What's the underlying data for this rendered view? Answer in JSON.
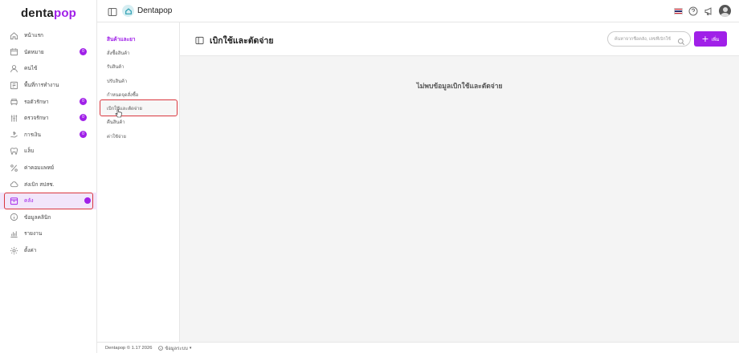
{
  "app": {
    "logo_main": "denta",
    "logo_accent": "pop",
    "brand_name": "Dentapop"
  },
  "colors": {
    "accent": "#a020e8",
    "highlight": "#d9363e"
  },
  "sidebar": {
    "items": [
      {
        "label": "หน้าแรก",
        "icon": "home-icon",
        "badge": ""
      },
      {
        "label": "นัดหมาย",
        "icon": "calendar-icon",
        "badge": "0"
      },
      {
        "label": "คนไข้",
        "icon": "user-icon",
        "badge": ""
      },
      {
        "label": "พื้นที่การทำงาน",
        "icon": "workspace-icon",
        "badge": ""
      },
      {
        "label": "รอตัวรักษา",
        "icon": "chair-icon",
        "badge": "0"
      },
      {
        "label": "ตรวจรักษา",
        "icon": "tools-icon",
        "badge": "0"
      },
      {
        "label": "การเงิน",
        "icon": "money-icon",
        "badge": "0"
      },
      {
        "label": "แล็บ",
        "icon": "tooth-icon",
        "badge": ""
      },
      {
        "label": "ค่าคอมแพทย์",
        "icon": "percent-icon",
        "badge": ""
      },
      {
        "label": "ส่งเบิก สปสช.",
        "icon": "cloud-icon",
        "badge": ""
      },
      {
        "label": "คลัง",
        "icon": "box-icon",
        "badge": ""
      },
      {
        "label": "ข้อมูลคลินิก",
        "icon": "info-icon",
        "badge": ""
      },
      {
        "label": "รายงาน",
        "icon": "chart-icon",
        "badge": ""
      },
      {
        "label": "ตั้งค่า",
        "icon": "gear-icon",
        "badge": ""
      }
    ]
  },
  "submenu": {
    "title": "สินค้าและยา",
    "items": [
      "สั่งซื้อสินค้า",
      "รับสินค้า",
      "ปรับสินค้า",
      "กำหนดจุดสั่งซื้อ",
      "เบิกใช้และตัดจ่าย",
      "คืนสินค้า",
      "ค่าใช้จ่าย"
    ]
  },
  "main": {
    "title": "เบิกใช้และตัดจ่าย",
    "search_placeholder": "ค้นหาจากชื่อคลัง, เลขที่เบิกใช้",
    "add_label": "เพิ่ม",
    "empty_message": "ไม่พบข้อมูลเบิกใช้และตัดจ่าย"
  },
  "footer": {
    "copyright": "Dentapop © 1.17 2026",
    "system_info": "ข้อมูลระบบ"
  }
}
